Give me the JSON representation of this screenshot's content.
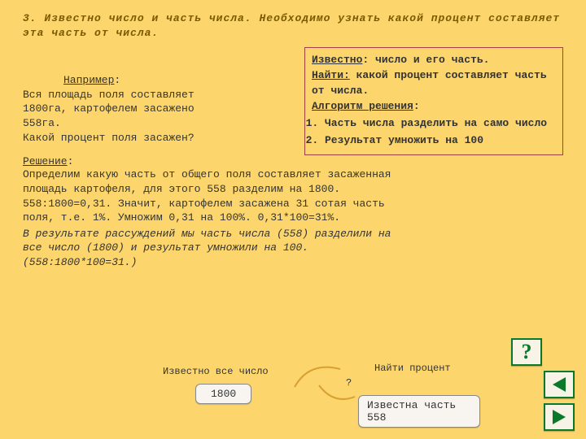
{
  "heading": {
    "num": "3.",
    "text": "Известно число и часть числа. Необходимо узнать какой процент составляет эта часть от числа."
  },
  "algo": {
    "known_label": "Известно",
    "known_text": ": число и его часть.",
    "find_label": "Найти:",
    "find_text": " какой процент составляет часть от числа.",
    "title": "Алгоритм решения",
    "step1": "Часть числа разделить на само число",
    "step2": "Результат умножить на 100"
  },
  "example": {
    "label": "Например",
    "l1": "Вся площадь поля составляет",
    "l2": "1800га, картофелем засажено",
    "l3": "558га.",
    "l4": "Какой процент поля засажен?"
  },
  "solution": {
    "label": "Решение",
    "t1": "Определим какую часть от общего поля составляет засаженная",
    "t2": "площадь картофеля, для этого 558 разделим на 1800.",
    "t3": "558:1800=0,31. Значит, картофелем засажена 31 сотая часть",
    "t4": "поля, т.е. 1%. Умножим 0,31 на 100%. 0,31*100=31%."
  },
  "conclusion": {
    "c1": "В результате рассуждений мы часть числа (558) разделили на",
    "c2": "все число (1800) и результат умножили на 100.",
    "c3": "(558:1800*100=31.)"
  },
  "bottom": {
    "whole_label": "Известно все число",
    "whole_value": "1800",
    "find_label": "Найти процент",
    "find_q": "?",
    "part_label": "Известна часть 558"
  },
  "nav": {
    "help": "?"
  }
}
